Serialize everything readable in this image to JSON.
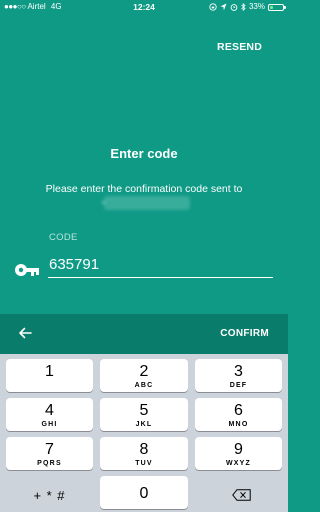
{
  "status": {
    "carrier": "Airtel",
    "network": "4G",
    "signal_dots": "●●●○○",
    "time": "12:24",
    "icons": [
      "location-icon",
      "lock-rotation-icon",
      "alarm-icon",
      "bluetooth-icon"
    ],
    "battery": "33%",
    "battery_level": 0.33
  },
  "header": {
    "resend": "RESEND"
  },
  "main": {
    "title": "Enter code",
    "description": "Please enter the confirmation code sent to",
    "code_label": "CODE",
    "code_value": "635791"
  },
  "actionbar": {
    "confirm": "CONFIRM"
  },
  "keyboard": {
    "keys": [
      {
        "num": "1",
        "letters": ""
      },
      {
        "num": "2",
        "letters": "ABC"
      },
      {
        "num": "3",
        "letters": "DEF"
      },
      {
        "num": "4",
        "letters": "GHI"
      },
      {
        "num": "5",
        "letters": "JKL"
      },
      {
        "num": "6",
        "letters": "MNO"
      },
      {
        "num": "7",
        "letters": "PQRS"
      },
      {
        "num": "8",
        "letters": "TUV"
      },
      {
        "num": "9",
        "letters": "WXYZ"
      }
    ],
    "symbols": "+ * #",
    "zero": "0"
  },
  "colors": {
    "background": "#0f9a86",
    "actionbar": "#0a7c6b",
    "keyboard": "#cdd3db"
  }
}
